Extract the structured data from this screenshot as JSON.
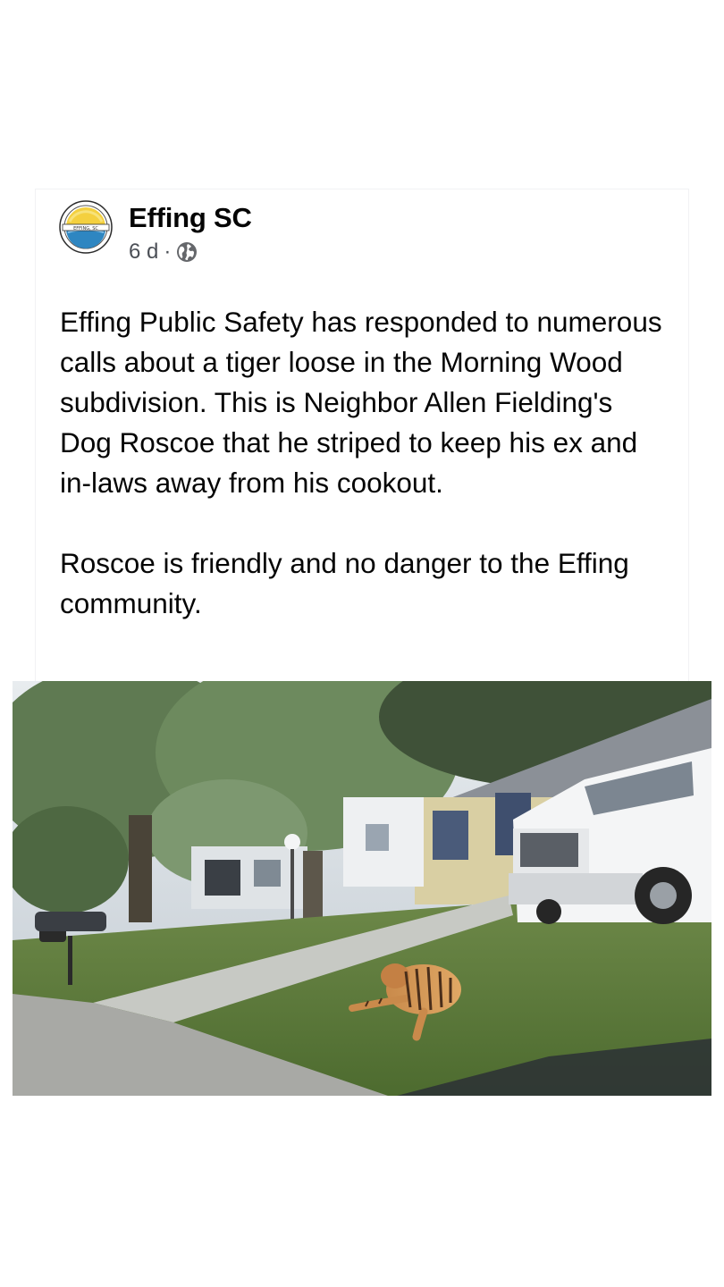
{
  "post": {
    "page_name": "Effing SC",
    "timestamp": "6 d",
    "separator": "·",
    "audience_icon": "globe-icon",
    "avatar_text": "EFFING, SC",
    "body_paragraphs": [
      "Effing Public Safety has responded to numerous calls about a tiger loose in the Morning Wood subdivision. This is Neighbor Allen Fielding's Dog Roscoe that he striped to keep his ex and in-laws away from his cookout.",
      "Roscoe is friendly and no danger to the Effing community."
    ],
    "photo_icon": "photo-tiger-dog-on-lawn"
  },
  "colors": {
    "page_background": "#ffffff",
    "text": "#050505",
    "meta_text": "#4b4f56",
    "logo_yellow": "#f4d03f",
    "logo_blue": "#2e86c1"
  }
}
